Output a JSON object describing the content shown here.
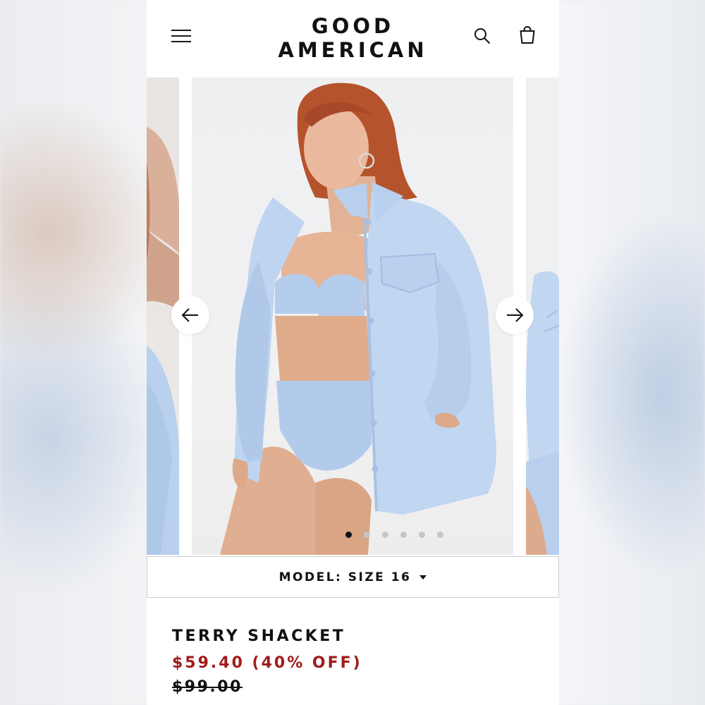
{
  "brand": {
    "logo_line1": "GOOD",
    "logo_line2": "AMERICAN"
  },
  "header": {
    "menu_icon": "hamburger-menu-icon",
    "search_icon": "search-icon",
    "bag_icon": "shopping-bag-icon"
  },
  "carousel": {
    "slide_count": 6,
    "active_index": 0,
    "prev_icon": "arrow-left-icon",
    "next_icon": "arrow-right-icon"
  },
  "size_selector": {
    "label": "MODEL: SIZE 16",
    "icon": "caret-down-icon"
  },
  "product": {
    "title": "TERRY SHACKET",
    "sale_price": "$59.40 (40% OFF)",
    "original_price": "$99.00"
  },
  "colors": {
    "accent_sale": "#a11b1b",
    "text": "#111111",
    "garment_blue": "#bcd3ef"
  }
}
